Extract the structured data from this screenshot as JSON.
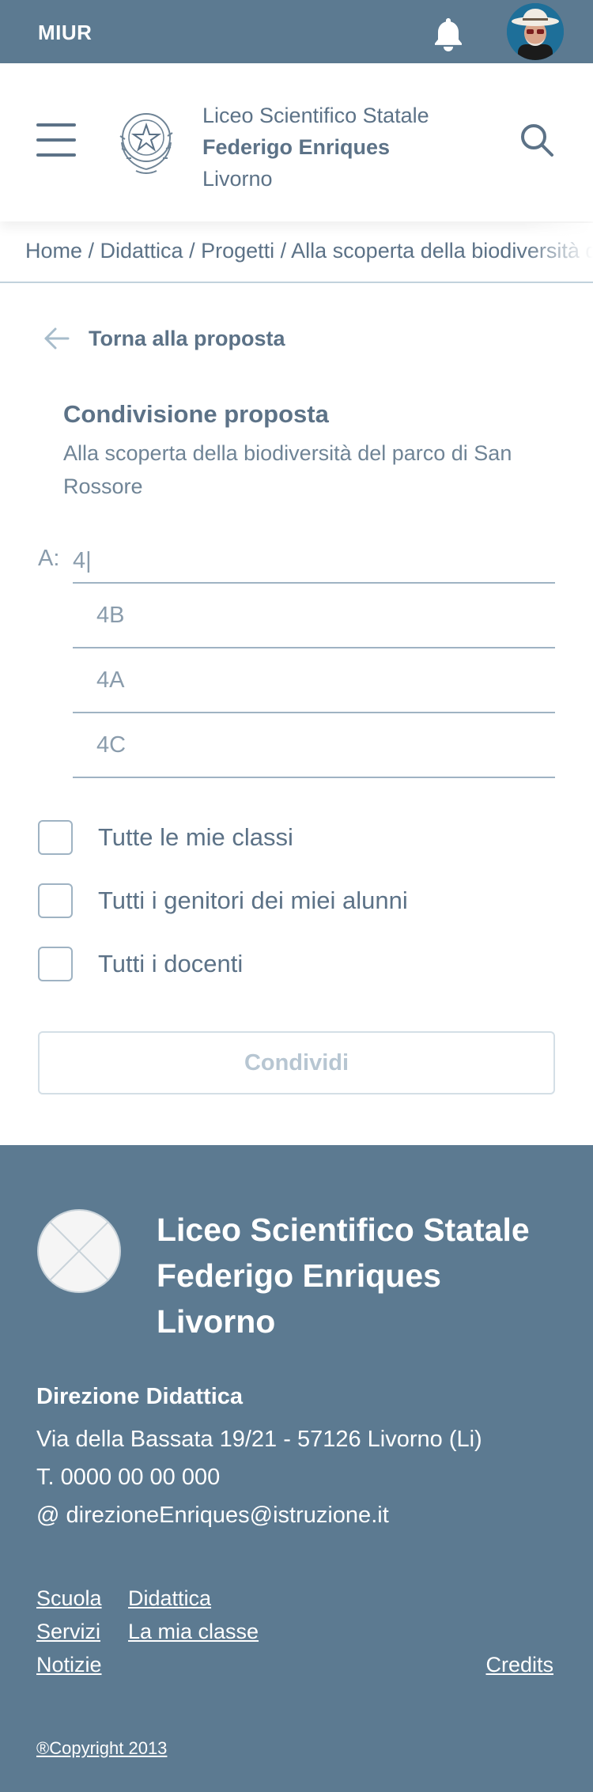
{
  "topbar": {
    "brand": "MIUR",
    "bell_icon": "bell-icon",
    "avatar": "user-avatar"
  },
  "header": {
    "menu_icon": "hamburger-menu-icon",
    "emblem": "italian-republic-emblem",
    "school_line1": "Liceo Scientifico Statale",
    "school_line2": "Federigo Enriques",
    "school_line3": "Livorno",
    "search_icon": "search-icon"
  },
  "breadcrumb": {
    "text": "Home / Didattica / Progetti / Alla scoperta della biodiversità del parco di San Rossore"
  },
  "back": {
    "label": "Torna alla proposta",
    "icon": "arrow-left-icon"
  },
  "share": {
    "title": "Condivisione proposta",
    "subtitle": "Alla scoperta della biodiversità del parco di San Rossore",
    "to_label": "A:",
    "to_value": "4|",
    "suggestions": [
      "4B",
      "4A",
      "4C"
    ],
    "options": [
      "Tutte le mie classi",
      "Tutti i genitori dei miei alunni",
      "Tutti i docenti"
    ],
    "button": "Condividi"
  },
  "footer": {
    "title_line1": "Liceo Scientifico Statale",
    "title_line2": "Federigo Enriques",
    "title_line3": "Livorno",
    "direction": "Direzione Didattica",
    "address": "Via della Bassata 19/21 - 57126 Livorno (Li)",
    "phone": "T. 0000 00 00 000",
    "email": "@ direzioneEnriques@istruzione.it",
    "links": {
      "scuola": "Scuola",
      "didattica": "Didattica",
      "servizi": "Servizi",
      "classe": "La mia classe",
      "notizie": "Notizie",
      "credits": "Credits"
    },
    "copyright": "®Copyright 2013"
  },
  "colors": {
    "primary": "#5c7a91",
    "text": "#5c7287",
    "muted": "#8a9cac",
    "border": "#9fb3c3"
  }
}
